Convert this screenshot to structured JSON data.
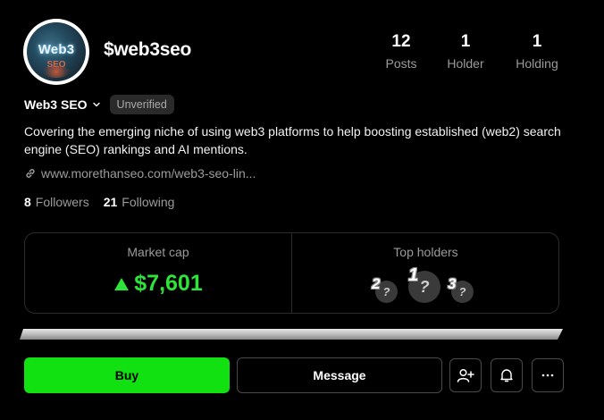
{
  "profile": {
    "avatar_text": "Web3",
    "avatar_subtext": "SEO",
    "handle": "$web3seo",
    "display_name": "Web3 SEO",
    "verification_badge": "Unverified",
    "bio": "Covering the emerging niche of using web3 platforms to help boosting established (web2) search engine (SEO) rankings and AI mentions.",
    "link": "www.morethanseo.com/web3-seo-lin..."
  },
  "stats": [
    {
      "value": "12",
      "label": "Posts"
    },
    {
      "value": "1",
      "label": "Holder"
    },
    {
      "value": "1",
      "label": "Holding"
    }
  ],
  "follow": {
    "followers_count": "8",
    "followers_label": "Followers",
    "following_count": "21",
    "following_label": "Following"
  },
  "market": {
    "label": "Market cap",
    "value": "$7,601",
    "trend": "up",
    "accent_color": "#2ee33a"
  },
  "top_holders": {
    "label": "Top holders",
    "holders": [
      {
        "rank": "2",
        "glyph": "?"
      },
      {
        "rank": "1",
        "glyph": "?"
      },
      {
        "rank": "3",
        "glyph": "?"
      }
    ]
  },
  "actions": {
    "buy_label": "Buy",
    "message_label": "Message",
    "buy_color": "#11e011",
    "icons": [
      "add-user-icon",
      "bell-icon",
      "more-icon"
    ]
  }
}
